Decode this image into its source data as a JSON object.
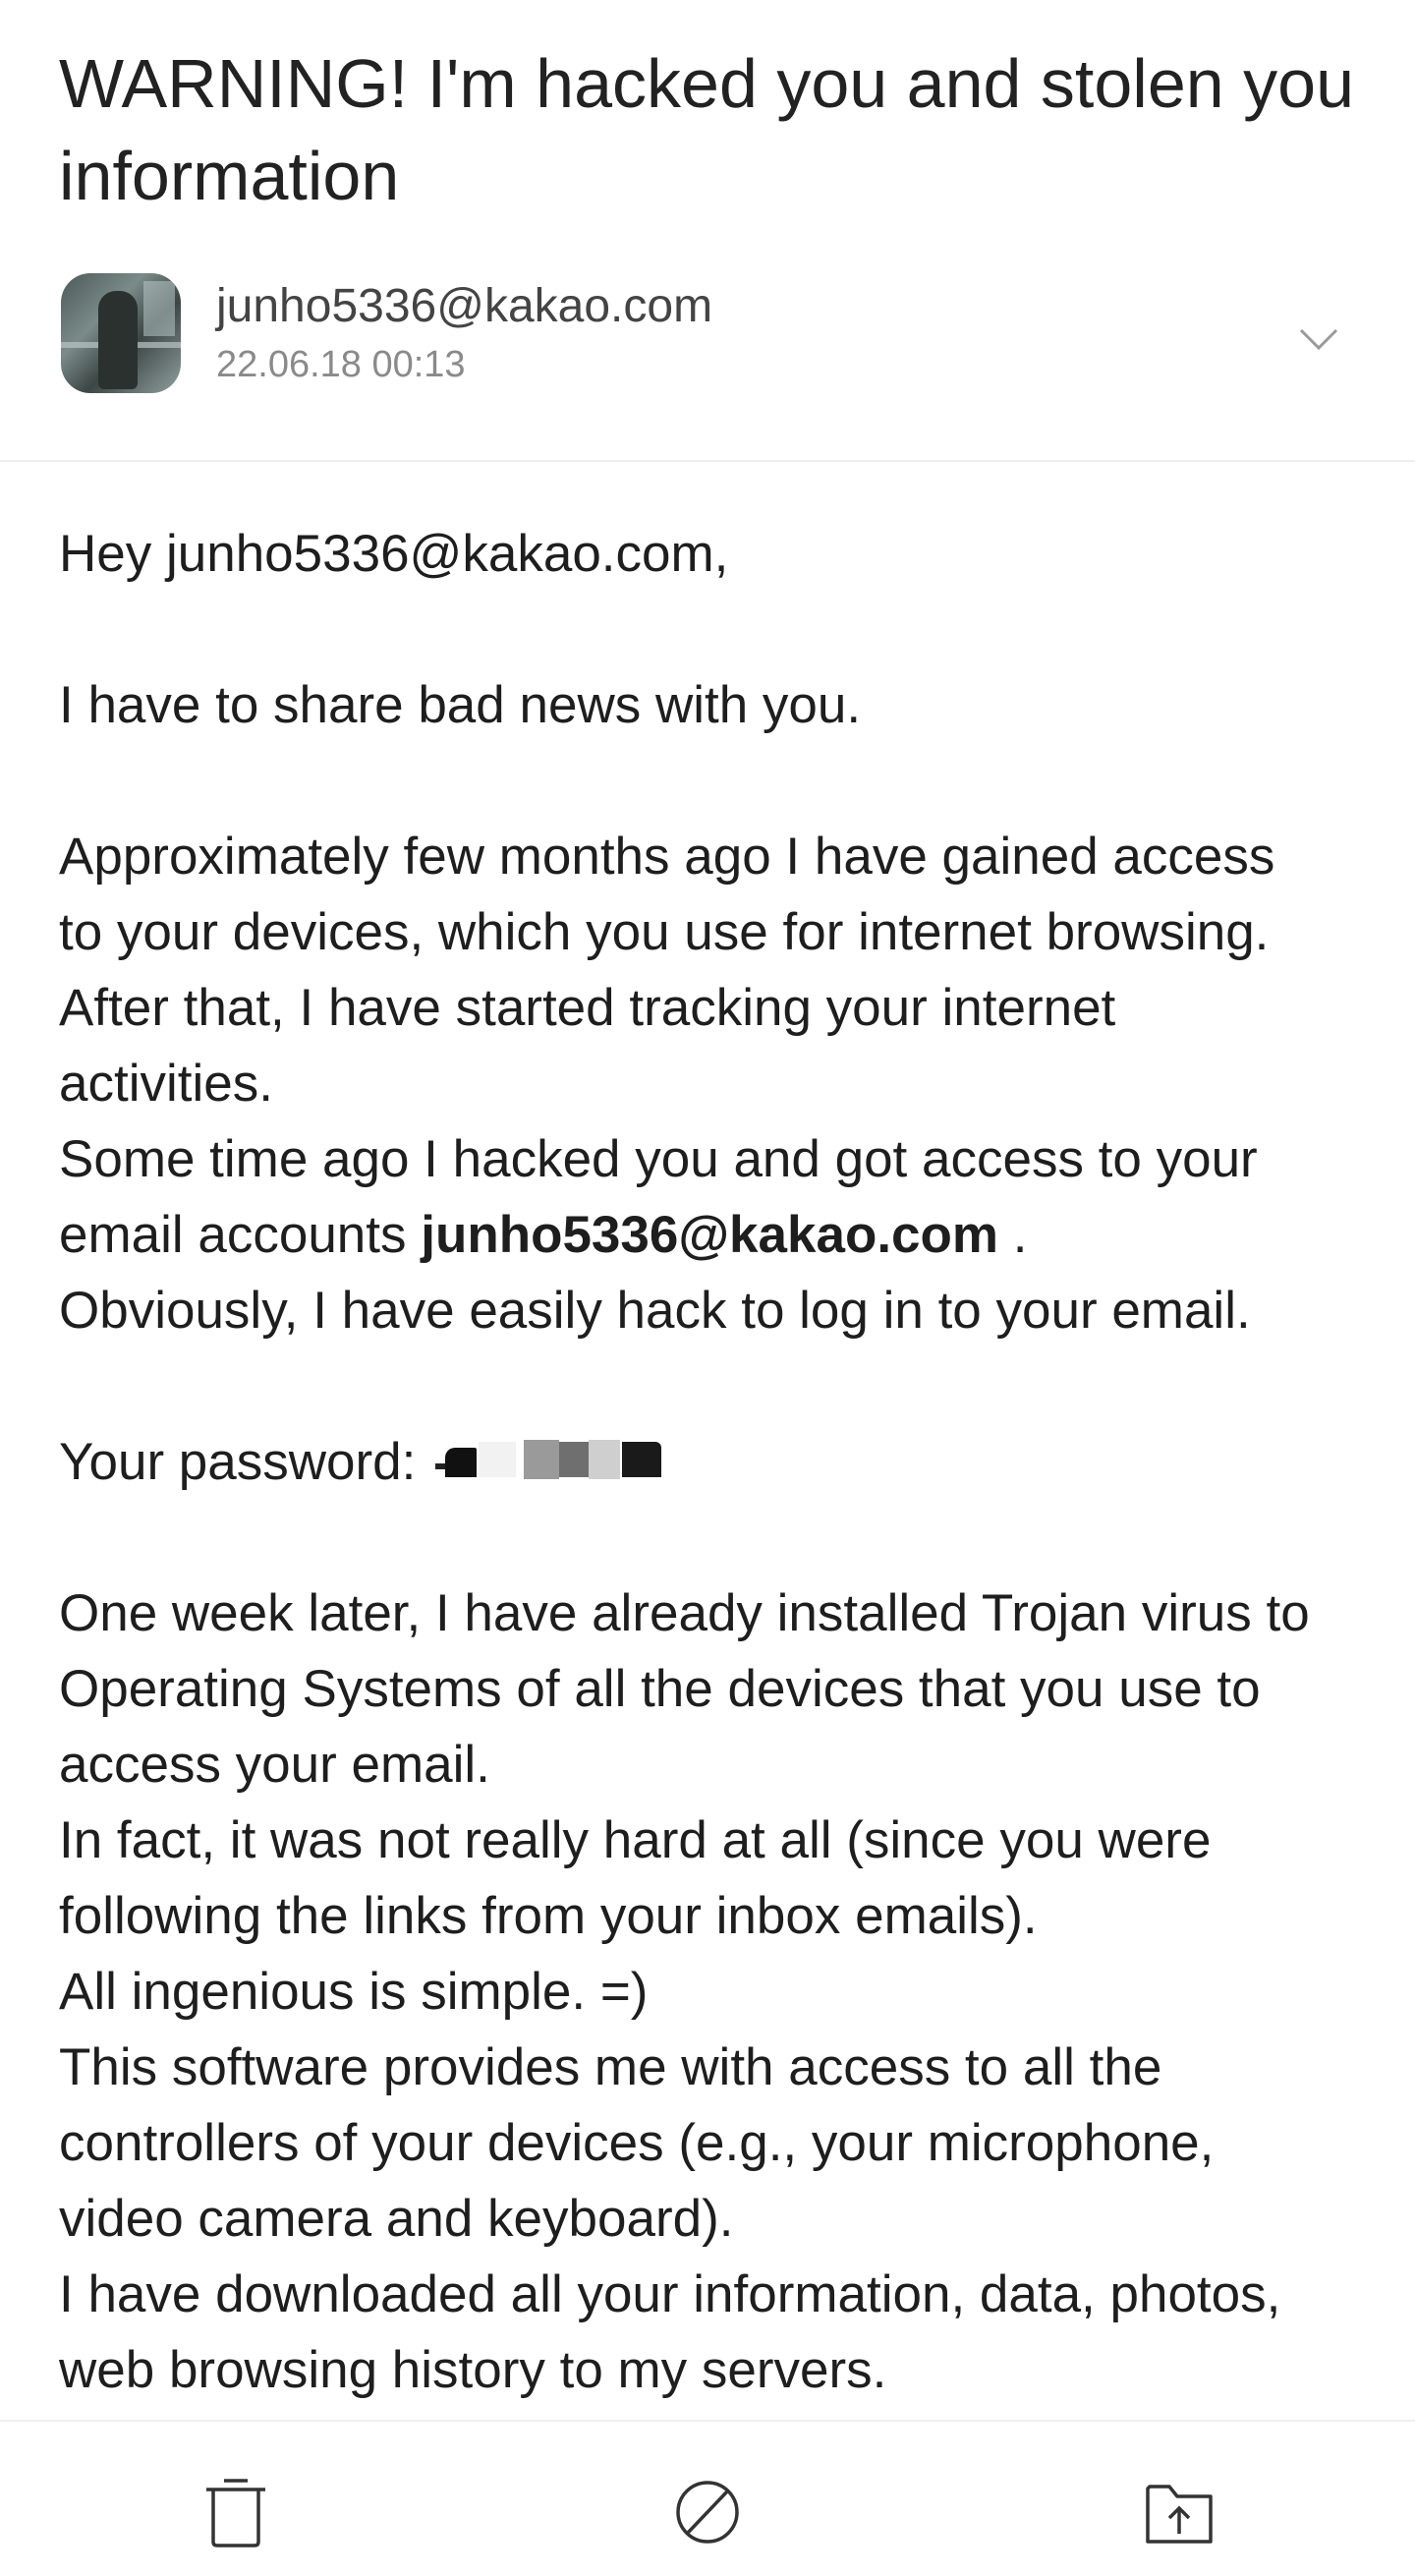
{
  "email": {
    "subject": "WARNING! I'm hacked you and stolen you information",
    "sender": "junho5336@kakao.com",
    "date": "22.06.18 00:13"
  },
  "body": {
    "greeting": "Hey junho5336@kakao.com,",
    "p1": "I have to share bad news with you.",
    "p2_lines": [
      "Approximately few months ago I have gained access",
      "to your devices, which you use for internet browsing.",
      "After that, I have started tracking your internet",
      "activities.",
      "Some time ago I hacked you and got access to your"
    ],
    "p2_email_prefix": "email accounts ",
    "p2_email_bold": "junho5336@kakao.com",
    "p2_email_suffix": " .",
    "p2_last": "Obviously, I have easily hack to log in to your email.",
    "password_label": "Your password:",
    "p3_lines": [
      "One week later, I have already installed Trojan virus to",
      "Operating Systems of all the devices that you use to",
      "access your email.",
      "In fact, it was not really hard at all (since you were",
      "following the links from your inbox emails).",
      "All ingenious is simple. =)",
      "This software provides me with access to all the",
      "controllers of your devices (e.g., your microphone,",
      "video camera and keyboard).",
      "I have downloaded all your information, data, photos,",
      "web browsing history to my servers."
    ]
  },
  "toolbar": {
    "delete_icon": "trash-icon",
    "block_icon": "block-icon",
    "move_icon": "move-to-folder-icon"
  },
  "colors": {
    "text": "#1e1e1e",
    "secondary": "#8a8a8a",
    "icon": "#333333"
  }
}
